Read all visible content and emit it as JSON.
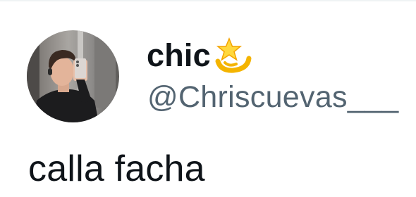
{
  "tweet": {
    "author": {
      "display_name": "chic",
      "name_emoji": "dizzy-star-icon",
      "handle": "@Chriscuevas___"
    },
    "text": "calla facha"
  },
  "colors": {
    "name_text": "#0f1419",
    "handle_text": "#536471",
    "emoji_gold": "#f4b400",
    "emoji_star": "#ffd83d"
  }
}
